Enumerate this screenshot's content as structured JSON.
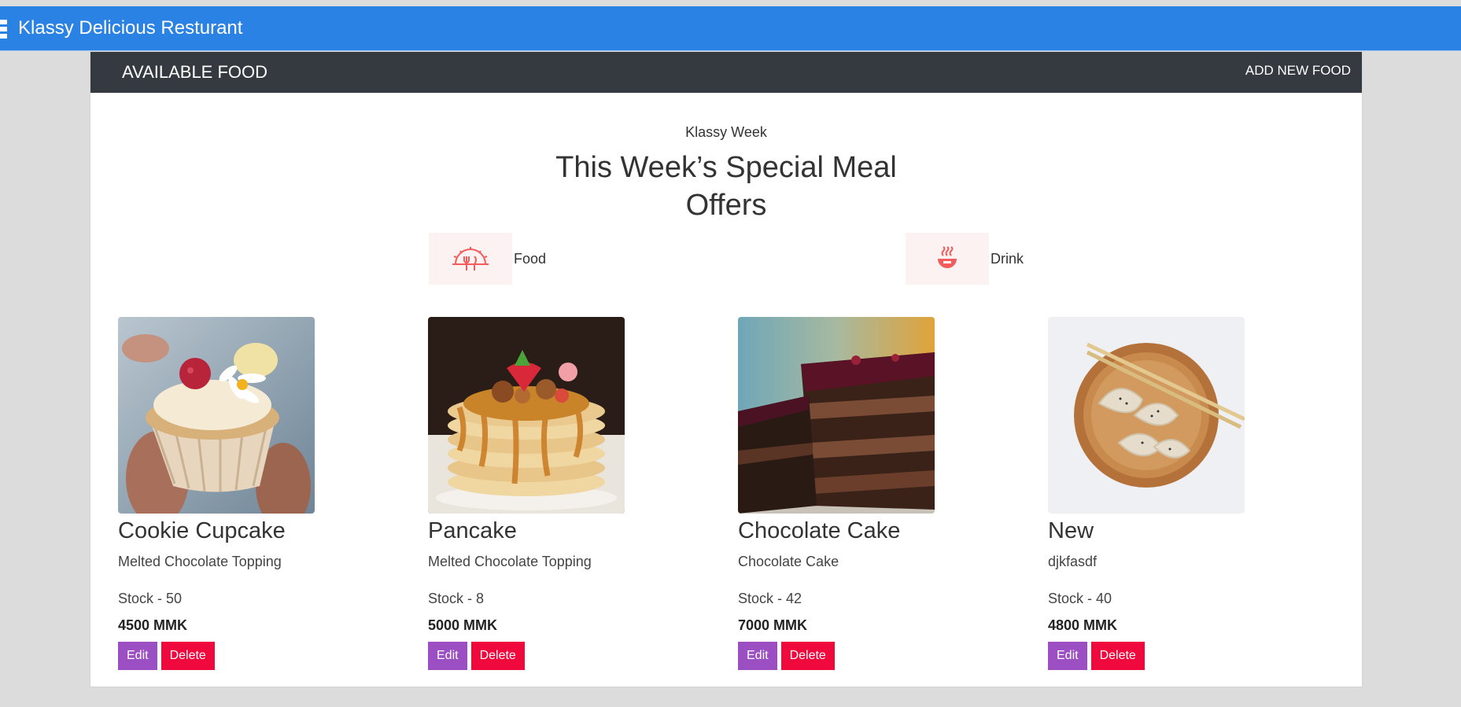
{
  "app": {
    "title": "Klassy Delicious Resturant"
  },
  "panel": {
    "title": "AVAILABLE FOOD",
    "add_link": "ADD NEW FOOD"
  },
  "section": {
    "kicker": "Klassy Week",
    "heading_line1": "This Week’s Special Meal",
    "heading_line2": "Offers"
  },
  "categories": [
    {
      "label": "Food",
      "icon": "dish-icon"
    },
    {
      "label": "Drink",
      "icon": "hot-drink-icon"
    }
  ],
  "foods": [
    {
      "name": "Cookie Cupcake",
      "description": "Melted Chocolate Topping",
      "stock": "Stock - 50",
      "price": "4500 MMK",
      "image": "cupcake-image"
    },
    {
      "name": "Pancake",
      "description": "Melted Chocolate Topping",
      "stock": "Stock - 8",
      "price": "5000 MMK",
      "image": "pancake-image"
    },
    {
      "name": "Chocolate Cake",
      "description": "Chocolate Cake",
      "stock": "Stock - 42",
      "price": "7000 MMK",
      "image": "chocolate-cake-image"
    },
    {
      "name": "New",
      "description": "djkfasdf",
      "stock": "Stock - 40",
      "price": "4800 MMK",
      "image": "dumplings-image"
    }
  ],
  "buttons": {
    "edit": "Edit",
    "delete": "Delete"
  },
  "colors": {
    "topbar": "#2a82e4",
    "panel_header": "#343a40",
    "edit": "#9b4fc2",
    "delete": "#f0093d",
    "category_icon": "#f25c5c"
  }
}
